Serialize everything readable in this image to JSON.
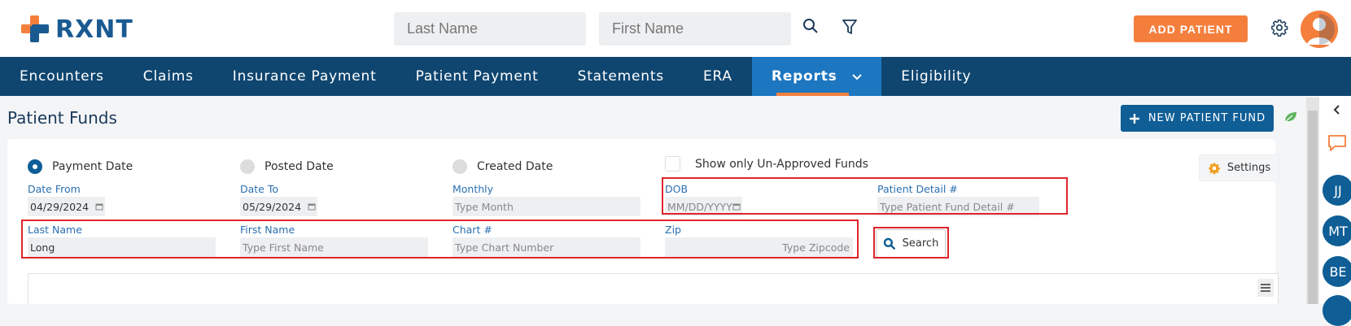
{
  "app": {
    "logo_text": "RXNT"
  },
  "topbar": {
    "last_name_placeholder": "Last Name",
    "first_name_placeholder": "First Name",
    "add_patient_label": "ADD PATIENT",
    "search_icon": "search-icon",
    "filter_icon": "filter-icon",
    "settings_icon": "gear-icon"
  },
  "nav": {
    "items": [
      {
        "label": "Encounters"
      },
      {
        "label": "Claims"
      },
      {
        "label": "Insurance Payment"
      },
      {
        "label": "Patient Payment"
      },
      {
        "label": "Statements"
      },
      {
        "label": "ERA"
      },
      {
        "label": "Reports",
        "active": true
      },
      {
        "label": "Eligibility"
      }
    ]
  },
  "page": {
    "title": "Patient Funds",
    "new_fund_label": "NEW PATIENT FUND"
  },
  "filters": {
    "radio": {
      "payment_date": "Payment Date",
      "posted_date": "Posted Date",
      "created_date": "Created Date",
      "selected": "Payment Date"
    },
    "unapproved_label": "Show only Un-Approved Funds",
    "settings_label": "Settings",
    "date_from": {
      "label": "Date From",
      "value": "04/29/2024"
    },
    "date_to": {
      "label": "Date To",
      "value": "05/29/2024"
    },
    "monthly": {
      "label": "Monthly",
      "placeholder": "Type Month"
    },
    "dob": {
      "label": "DOB",
      "placeholder": "MM/DD/YYYY"
    },
    "patient_detail": {
      "label": "Patient Detail #",
      "placeholder": "Type Patient Fund Detail #"
    },
    "last_name": {
      "label": "Last Name",
      "value": "Long"
    },
    "first_name": {
      "label": "First Name",
      "placeholder": "Type First Name"
    },
    "chart": {
      "label": "Chart #",
      "placeholder": "Type Chart Number"
    },
    "zip": {
      "label": "Zip",
      "placeholder": "Type Zipcode"
    },
    "search_label": "Search"
  },
  "rail": {
    "circles": [
      "JJ",
      "MT",
      "BE"
    ]
  },
  "colors": {
    "brand_blue": "#0f4670",
    "accent_orange": "#f47f3d",
    "active_tab": "#1d76c0",
    "highlight_red": "#e0242c"
  }
}
